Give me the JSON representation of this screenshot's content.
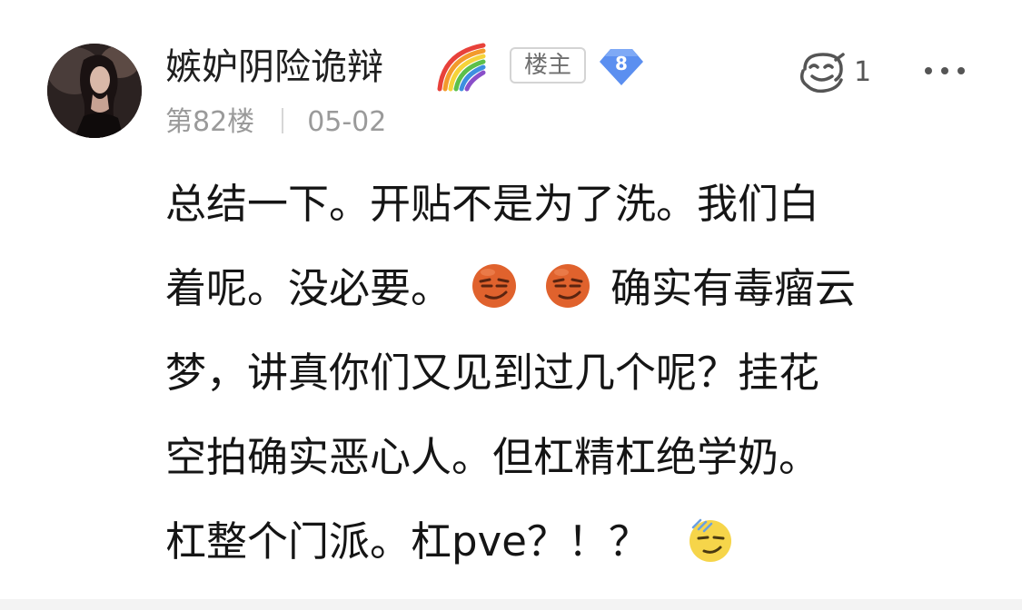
{
  "post": {
    "username": "嫉妒阴险诡辩",
    "owner_badge": "楼主",
    "level": "8",
    "floor": "第82楼",
    "date": "05-02",
    "reaction_count": "1",
    "icons": {
      "rainbow": "rainbow-icon",
      "level": "level-diamond-icon",
      "reaction": "reaction-face-icon",
      "more": "more-dots-icon",
      "emoji_smug": "smug-face-emoji",
      "emoji_cool": "cool-face-emoji"
    },
    "colors": {
      "level_badge": "#5b8ff0",
      "meta_text": "#9a9a9a",
      "emoji_smug": "#e0622d",
      "emoji_cool": "#f6d54a"
    },
    "content": {
      "line1": "总结一下。开贴不是为了洗。我们白",
      "line2_a": "着呢。没必要。",
      "line2_b": "确实有毒瘤云",
      "line3": "梦，讲真你们又见到过几个呢？挂花",
      "line4": "空拍确实恶心人。但杠精杠绝学奶。",
      "line5": "杠整个门派。杠pve？！？"
    }
  }
}
